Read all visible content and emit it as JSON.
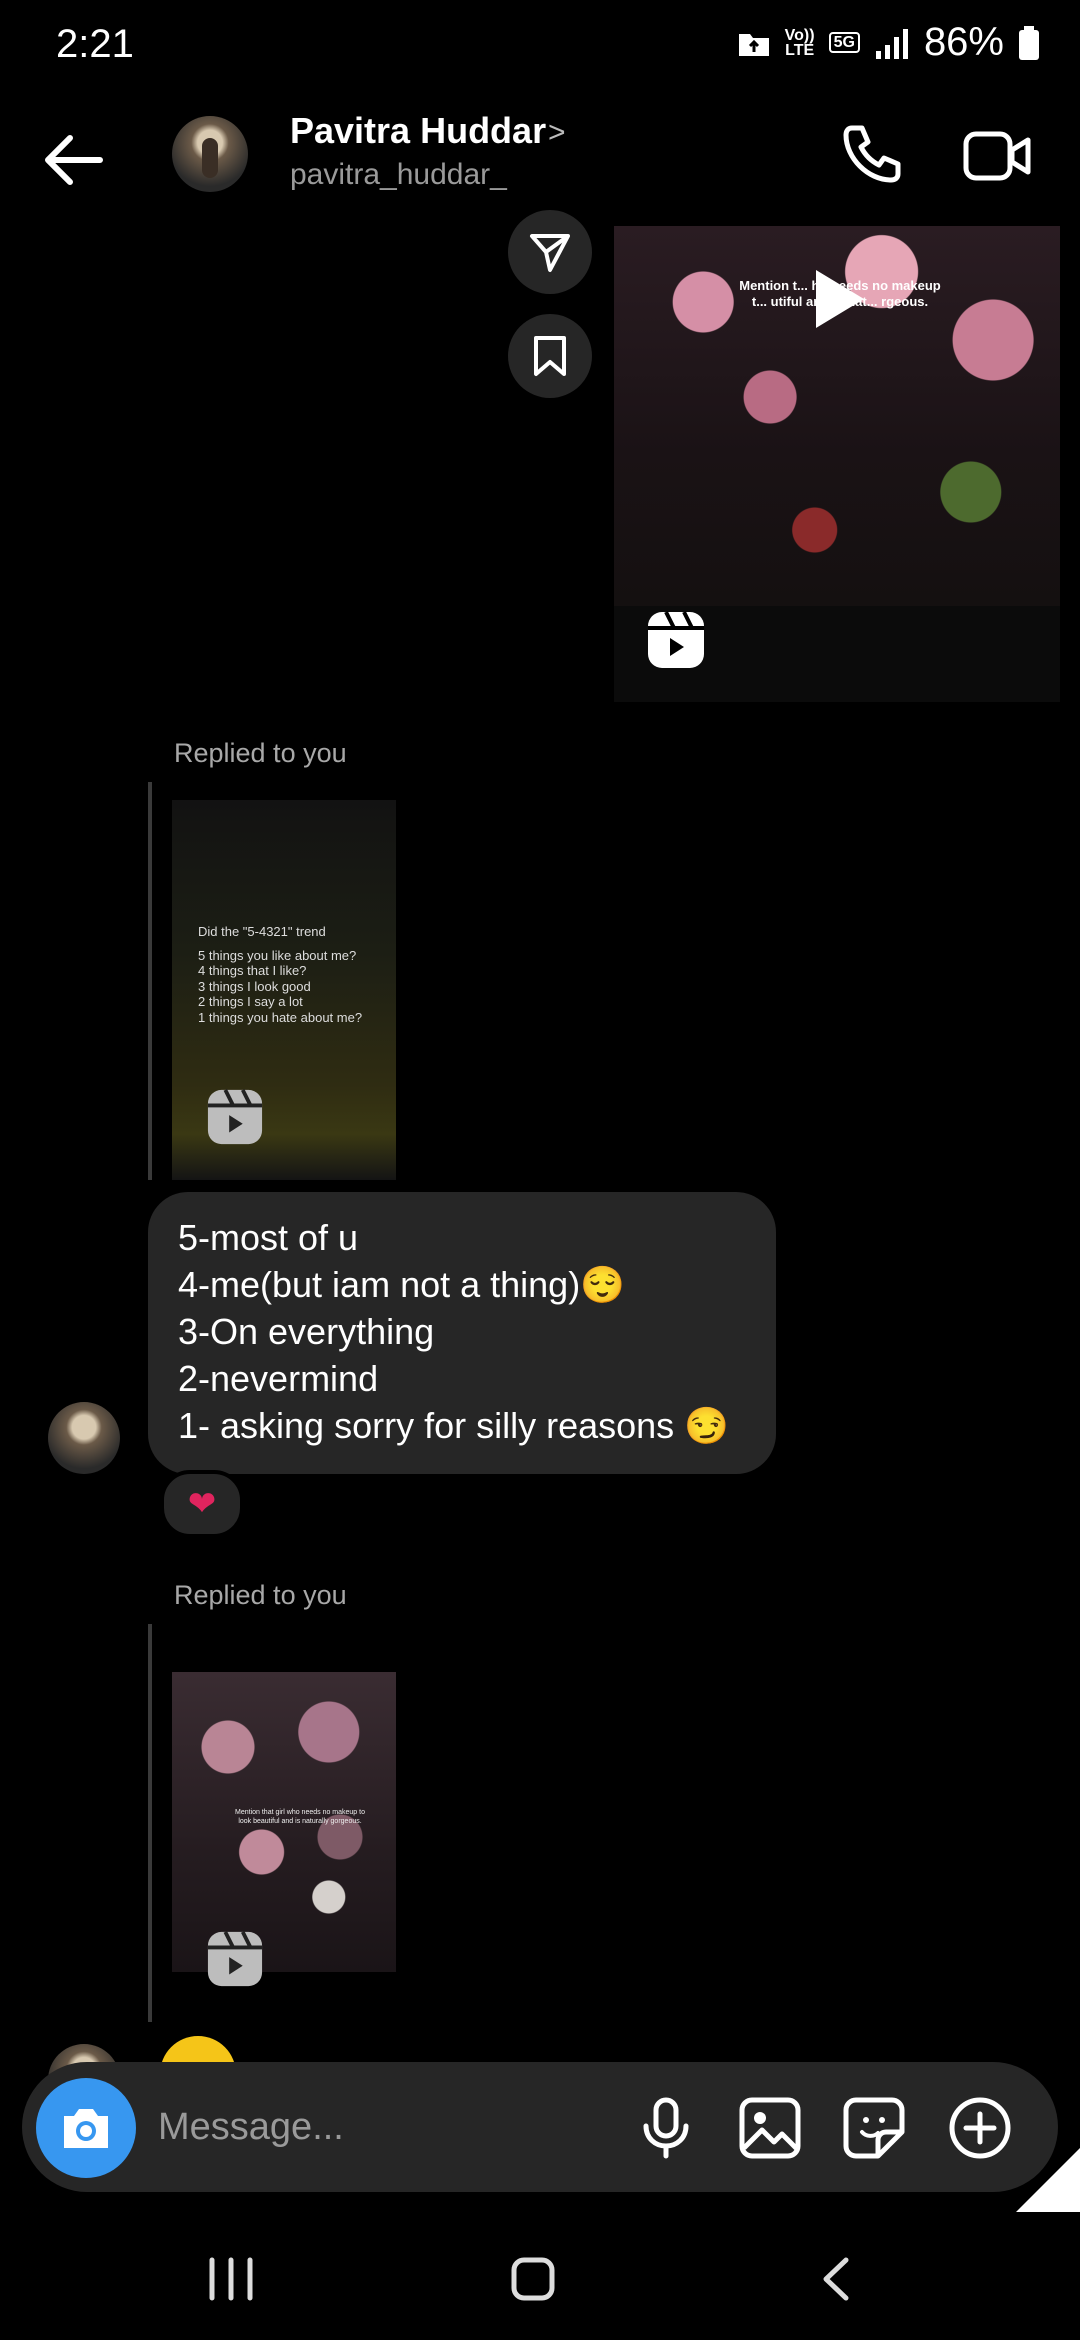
{
  "status_bar": {
    "time": "2:21",
    "net_top": "Vo))",
    "net_bottom": "LTE",
    "five_g": "5G",
    "battery": "86%"
  },
  "header": {
    "name": "Pavitra Huddar",
    "username": "pavitra_huddar_",
    "chevron": ">"
  },
  "reel_top": {
    "overlay_text": "Mention t... ho needs no makeup t... utiful and is nat... rgeous."
  },
  "replies": [
    {
      "label": "Replied to you",
      "thumb_text": [
        "Did the \"5-4321\" trend",
        "",
        "5 things you like about me?",
        "4 things that I like?",
        "3 things I look good",
        "2 things I say a lot",
        "1 things you hate about me?"
      ]
    },
    {
      "label": "Replied to you",
      "thumb_text": "Mention that girl who needs no makeup to look beautiful and is naturally gorgeous."
    }
  ],
  "message": {
    "lines": [
      "5-most of u",
      "4-me(but iam not a thing)😌",
      "3-On everything",
      "2-nevermind",
      "1- asking sorry for silly reasons 😏"
    ],
    "reaction": "❤"
  },
  "composer": {
    "placeholder": "Message..."
  },
  "icons": {
    "camera": "camera-icon",
    "mic": "mic-icon",
    "gallery": "gallery-icon",
    "sticker": "sticker-icon",
    "plus": "plus-icon"
  },
  "colors": {
    "accent": "#3797f0",
    "bubble": "#262626",
    "background": "#000000"
  }
}
